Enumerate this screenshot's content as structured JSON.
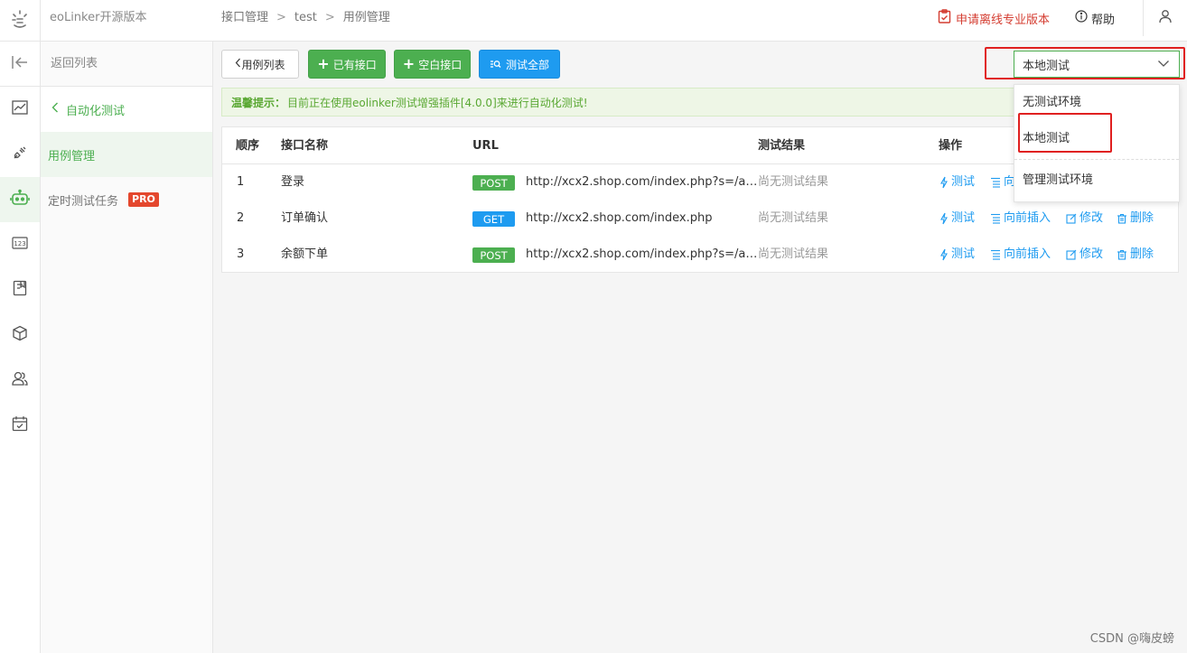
{
  "header": {
    "app_title": "eoLinker开源版本",
    "breadcrumb": [
      "接口管理",
      "test",
      "用例管理"
    ],
    "breadcrumb_sep": ">",
    "apply_pro_label": "申请离线专业版本",
    "help_label": "帮助"
  },
  "subnav": {
    "back_label": "返回列表",
    "group_label": "自动化测试",
    "items": [
      {
        "label": "用例管理",
        "active": true
      },
      {
        "label": "定时测试任务",
        "badge": "PRO"
      }
    ]
  },
  "toolbar": {
    "back_label": "用例列表",
    "existing_api_label": "已有接口",
    "blank_api_label": "空白接口",
    "test_all_label": "测试全部"
  },
  "env_select": {
    "value": "本地测试",
    "options": [
      "无测试环境",
      "本地测试",
      "管理测试环境"
    ]
  },
  "tip": {
    "title": "温馨提示：",
    "text": "目前正在使用eolinker测试增强插件[4.0.0]来进行自动化测试!"
  },
  "table": {
    "columns": [
      "顺序",
      "接口名称",
      "URL",
      "测试结果",
      "操作"
    ],
    "rows": [
      {
        "order": "1",
        "name": "登录",
        "method": "POST",
        "url": "http://xcx2.shop.com/index.php?s=/a…",
        "result": "尚无测试结果"
      },
      {
        "order": "2",
        "name": "订单确认",
        "method": "GET",
        "url": "http://xcx2.shop.com/index.php",
        "result": "尚无测试结果"
      },
      {
        "order": "3",
        "name": "余额下单",
        "method": "POST",
        "url": "http://xcx2.shop.com/index.php?s=/a…",
        "result": "尚无测试结果"
      }
    ],
    "actions": {
      "test": "测试",
      "insert": "向前插入",
      "insert_truncated": "向",
      "edit": "修改",
      "delete": "删除"
    }
  },
  "watermark": "CSDN @嗨皮螃",
  "colors": {
    "accent_green": "#4caf50",
    "accent_blue": "#1e9bf0",
    "highlight_red": "#e02020",
    "pro_red": "#e4472d"
  }
}
